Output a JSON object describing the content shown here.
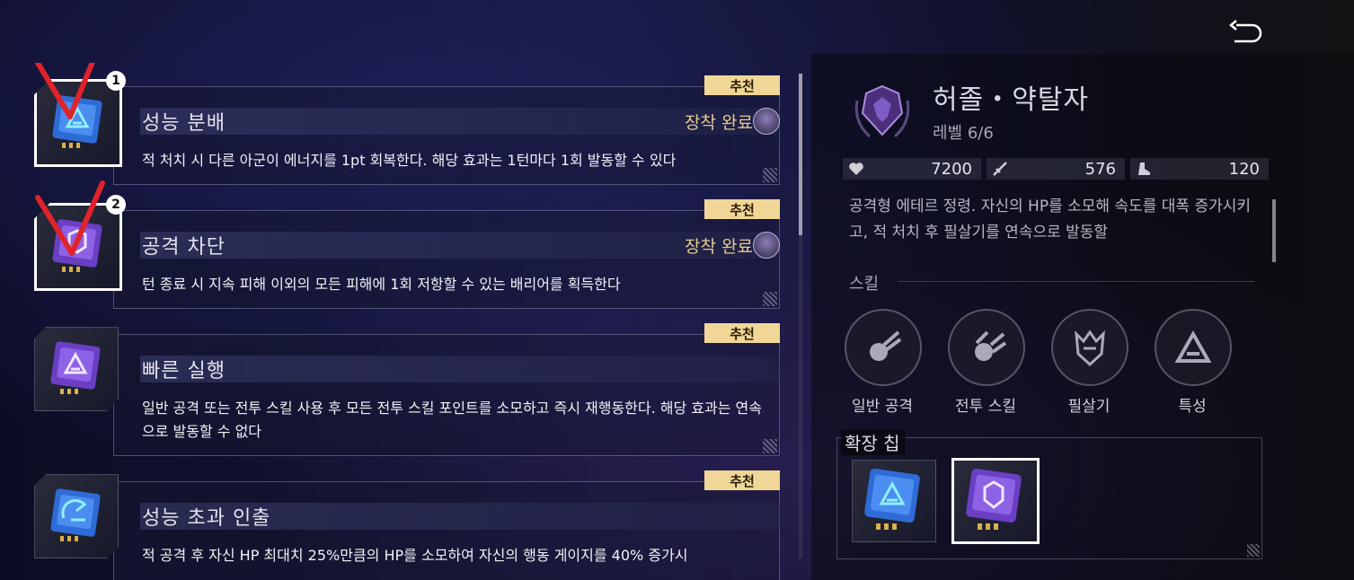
{
  "colors": {
    "accent_gold": "#f1d797",
    "equipped_gold": "#e6c98e",
    "chip_blue": "#2f6bd6",
    "chip_purple": "#7a4bd1",
    "annotation_red": "#e0232a"
  },
  "header": {
    "back_icon": "return-arrow-icon"
  },
  "chips": [
    {
      "title": "성능 분배",
      "recommend": "추천",
      "equipped": "장착 완료",
      "description": "적 처치 시 다른 아군이 에너지를 1pt 회복한다. 해당 효과는 1턴마다 1회 발동할 수 있다",
      "color": "blue",
      "selected": true,
      "annotation_number": "1"
    },
    {
      "title": "공격 차단",
      "recommend": "추천",
      "equipped": "장착 완료",
      "description": "턴 종료 시 지속 피해 이외의 모든 피해에 1회 저항할 수 있는 배리어를 획득한다",
      "color": "purple",
      "selected": true,
      "annotation_number": "2"
    },
    {
      "title": "빠른 실행",
      "recommend": "추천",
      "equipped": "",
      "description": "일반 공격 또는 전투 스킬 사용 후 모든 전투 스킬 포인트를 소모하고 즉시 재행동한다. 해당 효과는 연속으로 발동할 수 없다",
      "color": "purple",
      "selected": false
    },
    {
      "title": "성능 초과 인출",
      "recommend": "추천",
      "equipped": "",
      "description": "적 공격 후 자신 HP 최대치 25%만큼의 HP를 소모하여 자신의 행동 게이지를 40% 증가시",
      "color": "blue",
      "selected": false
    }
  ],
  "character": {
    "name": "허졸・약탈자",
    "level": "레벨 6/6",
    "stats": {
      "hp": "7200",
      "attack": "576",
      "speed": "120"
    },
    "bio": "공격형 에테르 정령. 자신의 HP를 소모해 속도를 대폭 증가시키고, 적 처치 후 필살기를 연속으로 발동할"
  },
  "skills_section": {
    "label": "스킬",
    "items": [
      {
        "label": "일반 공격",
        "icon": "comet-icon"
      },
      {
        "label": "전투 스킬",
        "icon": "double-comet-icon"
      },
      {
        "label": "필살기",
        "icon": "crest-icon"
      },
      {
        "label": "특성",
        "icon": "triangle-trait-icon"
      }
    ]
  },
  "extension_chips": {
    "label": "확장 칩",
    "items": [
      {
        "color": "blue",
        "icon": "triangle-chip-icon",
        "selected": false
      },
      {
        "color": "purple",
        "icon": "shield-chip-icon",
        "selected": true
      }
    ]
  }
}
